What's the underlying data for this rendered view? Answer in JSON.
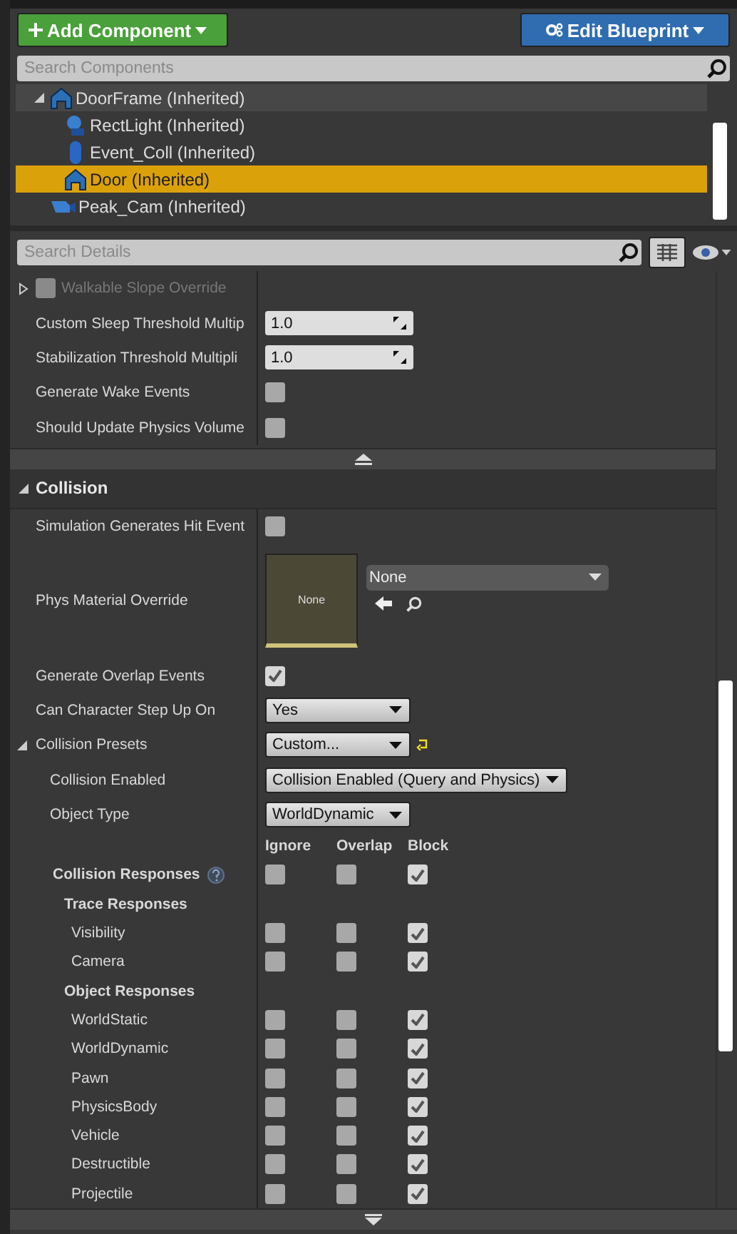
{
  "toolbar": {
    "add_label": "Add Component",
    "edit_label": "Edit Blueprint"
  },
  "component_search": {
    "placeholder": "Search Components"
  },
  "components": [
    {
      "label": "DoorFrame (Inherited)",
      "kind": "mesh",
      "expanded": true,
      "hovered": true,
      "selected": false,
      "children": [
        {
          "label": "RectLight (Inherited)",
          "kind": "light",
          "hovered": false,
          "selected": false
        },
        {
          "label": "Event_Coll (Inherited)",
          "kind": "capsule",
          "hovered": false,
          "selected": false
        },
        {
          "label": "Door (Inherited)",
          "kind": "mesh",
          "hovered": false,
          "selected": true
        }
      ]
    },
    {
      "label": "Peak_Cam (Inherited)",
      "kind": "camera",
      "hovered": false,
      "selected": false
    }
  ],
  "details_search": {
    "placeholder": "Search Details"
  },
  "physics_rows": [
    {
      "kind": "group-checkbox",
      "label": "Walkable Slope Override",
      "expanded": false,
      "checked": false,
      "disabled": true
    },
    {
      "kind": "number",
      "label": "Custom Sleep Threshold Multip",
      "value": "1.0"
    },
    {
      "kind": "number",
      "label": "Stabilization Threshold Multipli",
      "value": "1.0"
    },
    {
      "kind": "checkbox",
      "label": "Generate Wake Events",
      "checked": false
    },
    {
      "kind": "checkbox",
      "label": "Should Update Physics Volume",
      "checked": false
    }
  ],
  "collision": {
    "title": "Collision",
    "expanded": true,
    "rows": [
      {
        "kind": "checkbox",
        "label": "Simulation Generates Hit Event",
        "checked": false
      },
      {
        "kind": "asset",
        "label": "Phys Material Override",
        "thumb_label": "None",
        "value": "None"
      },
      {
        "kind": "checkbox",
        "label": "Generate Overlap Events",
        "checked": true
      },
      {
        "kind": "combo",
        "label": "Can Character Step Up On",
        "value": "Yes"
      },
      {
        "kind": "preset",
        "label": "Collision Presets",
        "value": "Custom...",
        "expanded": true
      },
      {
        "kind": "subcombo",
        "label": "Collision Enabled",
        "value": "Collision Enabled (Query and Physics)"
      },
      {
        "kind": "subcombo",
        "label": "Object Type",
        "value": "WorldDynamic"
      }
    ]
  },
  "responses": {
    "columns": [
      "Ignore",
      "Overlap",
      "Block"
    ],
    "title": "Collision Responses",
    "checks": [
      false,
      false,
      true
    ],
    "groups": [
      {
        "title": "Trace Responses",
        "items": [
          {
            "name": "Visibility",
            "checks": [
              false,
              false,
              true
            ]
          },
          {
            "name": "Camera",
            "checks": [
              false,
              false,
              true
            ]
          }
        ]
      },
      {
        "title": "Object Responses",
        "items": [
          {
            "name": "WorldStatic",
            "checks": [
              false,
              false,
              true
            ]
          },
          {
            "name": "WorldDynamic",
            "checks": [
              false,
              false,
              true
            ]
          },
          {
            "name": "Pawn",
            "checks": [
              false,
              false,
              true
            ]
          },
          {
            "name": "PhysicsBody",
            "checks": [
              false,
              false,
              true
            ]
          },
          {
            "name": "Vehicle",
            "checks": [
              false,
              false,
              true
            ]
          },
          {
            "name": "Destructible",
            "checks": [
              false,
              false,
              true
            ]
          },
          {
            "name": "Projectile",
            "checks": [
              false,
              false,
              true
            ]
          }
        ]
      }
    ]
  }
}
